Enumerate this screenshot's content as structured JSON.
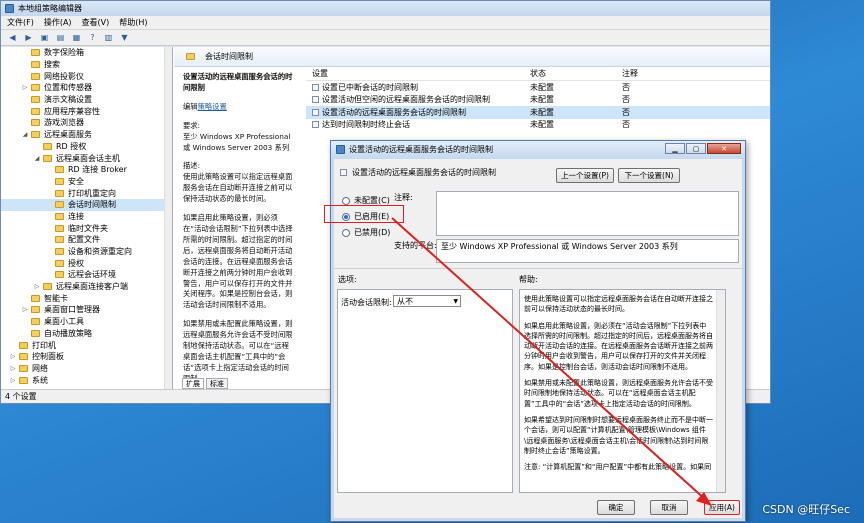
{
  "main_window": {
    "title": "本地组策略编辑器",
    "menu": [
      "文件(F)",
      "操作(A)",
      "查看(V)",
      "帮助(H)"
    ],
    "status": "4 个设置"
  },
  "tree": [
    {
      "label": "数字保险箱",
      "indent": 3,
      "exp": ""
    },
    {
      "label": "搜索",
      "indent": 3,
      "exp": ""
    },
    {
      "label": "网络投影仪",
      "indent": 3,
      "exp": ""
    },
    {
      "label": "位置和传感器",
      "indent": 3,
      "exp": "▷"
    },
    {
      "label": "演示文稿设置",
      "indent": 3,
      "exp": ""
    },
    {
      "label": "应用程序兼容性",
      "indent": 3,
      "exp": ""
    },
    {
      "label": "游戏浏览器",
      "indent": 3,
      "exp": ""
    },
    {
      "label": "远程桌面服务",
      "indent": 3,
      "exp": "◢"
    },
    {
      "label": "RD 授权",
      "indent": 4,
      "exp": ""
    },
    {
      "label": "远程桌面会话主机",
      "indent": 4,
      "exp": "◢"
    },
    {
      "label": "RD 连接 Broker",
      "indent": 5,
      "exp": ""
    },
    {
      "label": "安全",
      "indent": 5,
      "exp": ""
    },
    {
      "label": "打印机重定向",
      "indent": 5,
      "exp": ""
    },
    {
      "label": "会话时间限制",
      "indent": 5,
      "exp": "",
      "selected": true
    },
    {
      "label": "连接",
      "indent": 5,
      "exp": ""
    },
    {
      "label": "临时文件夹",
      "indent": 5,
      "exp": ""
    },
    {
      "label": "配置文件",
      "indent": 5,
      "exp": ""
    },
    {
      "label": "设备和资源重定向",
      "indent": 5,
      "exp": ""
    },
    {
      "label": "授权",
      "indent": 5,
      "exp": ""
    },
    {
      "label": "远程会话环境",
      "indent": 5,
      "exp": ""
    },
    {
      "label": "远程桌面连接客户端",
      "indent": 4,
      "exp": "▷"
    },
    {
      "label": "智能卡",
      "indent": 3,
      "exp": ""
    },
    {
      "label": "桌面窗口管理器",
      "indent": 3,
      "exp": "▷"
    },
    {
      "label": "桌面小工具",
      "indent": 3,
      "exp": ""
    },
    {
      "label": "自动播放策略",
      "indent": 3,
      "exp": ""
    },
    {
      "label": "打印机",
      "indent": 2,
      "exp": ""
    },
    {
      "label": "控制面板",
      "indent": 2,
      "exp": "▷"
    },
    {
      "label": "网络",
      "indent": 2,
      "exp": "▷"
    },
    {
      "label": "系统",
      "indent": 2,
      "exp": "▷"
    }
  ],
  "right_pane": {
    "header": "会话时间限制",
    "desc_title": "设置活动的远程桌面服务会话的时间限制",
    "edit_prefix": "编辑",
    "edit_link": "策略设置",
    "req_label": "要求:",
    "req_text": "至少 Windows XP Professional 或 Windows Server 2003 系列",
    "desc_label": "描述:",
    "desc_1": "使用此策略设置可以指定远程桌面服务会话在自动断开连接之前可以保持活动状态的最长时间。",
    "desc_2": "如果启用此策略设置，则必须在“活动会话限制”下拉列表中选择所需的时间限制。超过指定的时间后，远程桌面服务将自动断开活动会话的连接。在远程桌面服务会话断开连接之前两分钟时用户会收到警告，用户可以保存打开的文件并关闭程序。如果是控制台会话，则活动会话时间限制不适用。",
    "desc_3": "如果禁用或未配置此策略设置，则远程桌面服务允许会话不受时间限制地保持活动状态。可以在“远程桌面会话主机配置”工具中的“会话”选项卡上指定活动会话的时间限制。",
    "tabs": [
      "扩展",
      "标准"
    ],
    "columns": [
      "设置",
      "状态",
      "注释"
    ],
    "rows": [
      {
        "name": "设置已中断会话的时间限制",
        "state": "未配置",
        "note": "否"
      },
      {
        "name": "设置活动但空闲的远程桌面服务会话的时间限制",
        "state": "未配置",
        "note": "否"
      },
      {
        "name": "设置活动的远程桌面服务会话的时间限制",
        "state": "未配置",
        "note": "否",
        "selected": true
      },
      {
        "name": "达到时间限制时终止会话",
        "state": "未配置",
        "note": "否"
      }
    ]
  },
  "dialog": {
    "title": "设置活动的远程桌面服务会话的时间限制",
    "policy_name": "设置活动的远程桌面服务会话的时间限制",
    "prev_button": "上一个设置(P)",
    "next_button": "下一个设置(N)",
    "radio_not_configured": "未配置(C)",
    "radio_enabled": "已启用(E)",
    "radio_disabled": "已禁用(D)",
    "comment_label": "注释:",
    "support_label": "支持的平台:",
    "support_value": "至少 Windows XP Professional 或 Windows Server 2003 系列",
    "options_label": "选项:",
    "help_label": "帮助:",
    "session_limit_label": "活动会话限制:",
    "session_limit_value": "从不",
    "help_1": "使用此策略设置可以指定远程桌面服务会话在自动断开连接之前可以保持活动状态的最长时间。",
    "help_2": "如果启用此策略设置，则必须在“活动会话限制”下拉列表中选择所需的时间限制。超过指定的时间后，远程桌面服务将自动断开活动会话的连接。在远程桌面服务会话断开连接之前两分钟时用户会收到警告，用户可以保存打开的文件并关闭程序。如果是控制台会话，则活动会话时间限制不适用。",
    "help_3": "如果禁用或未配置此策略设置，则远程桌面服务允许会话不受时间限制地保持活动状态。可以在“远程桌面会话主机配置”工具中的“会话”选项卡上指定活动会话的时间限制。",
    "help_4": "如果希望达到时间限制时想要远程桌面服务终止而不是中断一个会话，则可以配置“计算机配置\\管理模板\\Windows 组件\\远程桌面服务\\远程桌面会话主机\\会话时间限制\\达到时间限制时终止会话”策略设置。",
    "help_5": "注意: “计算机配置”和“用户配置”中都有此策略设置。如果同",
    "ok": "确定",
    "cancel": "取消",
    "apply": "应用(A)"
  },
  "watermark": "CSDN @旺仔Sec"
}
